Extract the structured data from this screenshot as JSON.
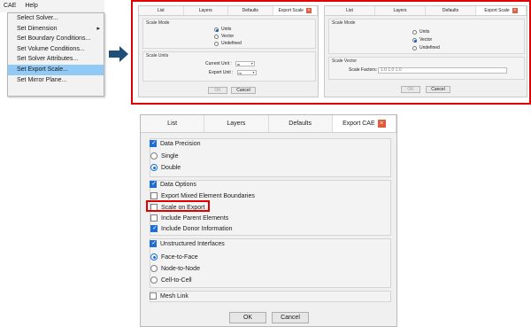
{
  "menubar": {
    "items": [
      "CAE",
      "Help"
    ]
  },
  "menu": {
    "items": [
      "Select Solver...",
      "Set Dimension",
      "Set Boundary Conditions...",
      "Set Volume Conditions...",
      "Set Solver Attributes...",
      "Set Export Scale...",
      "Set Mirror Plane..."
    ],
    "submenu_arrow": "▸",
    "highlight_color": "#91c9f7"
  },
  "arrow": {
    "color": "#1f4e79",
    "icon": "right-arrow-icon"
  },
  "accent": {
    "red_frame": "#e00000",
    "checked_blue": "#1e6ed3",
    "close_orange": "#e05c3d"
  },
  "left_dialog": {
    "tabs": [
      "List",
      "Layers",
      "Defaults",
      "Export Scale"
    ],
    "close_glyph": "×",
    "scale_mode": {
      "title": "Scale Mode",
      "options": [
        "Units",
        "Vector",
        "Undefined"
      ],
      "selected": 0
    },
    "scale_units": {
      "title": "Scale Units",
      "current_unit_label": "Current Unit :",
      "current_unit_value": "m",
      "export_unit_label": "Export Unit :",
      "export_unit_value": "m"
    },
    "ok": "OK",
    "cancel": "Cancel"
  },
  "right_dialog": {
    "tabs": [
      "List",
      "Layers",
      "Defaults",
      "Export Scale"
    ],
    "close_glyph": "×",
    "scale_mode": {
      "title": "Scale Mode",
      "options": [
        "Units",
        "Vector",
        "Undefined"
      ],
      "selected": 1
    },
    "scale_vector": {
      "title": "Scale Vector",
      "factors_label": "Scale Factors:",
      "factors_value": "1.0 1.0 1.0"
    },
    "ok": "OK",
    "cancel": "Cancel"
  },
  "main_dialog": {
    "tabs": [
      "List",
      "Layers",
      "Defaults",
      "Export CAE"
    ],
    "close_glyph": "×",
    "data_precision": {
      "title": "Data Precision",
      "checked": true,
      "options": [
        "Single",
        "Double"
      ],
      "selected": 1
    },
    "data_options": {
      "title": "Data Options",
      "checked": true,
      "items": [
        {
          "label": "Export Mixed Element Boundaries",
          "checked": false
        },
        {
          "label": "Scale on Export",
          "checked": false
        },
        {
          "label": "Include Parent Elements",
          "checked": false
        },
        {
          "label": "Include Donor Information",
          "checked": true
        }
      ]
    },
    "unstructured_interfaces": {
      "title": "Unstructured Interfaces",
      "checked": true,
      "options": [
        "Face-to-Face",
        "Node-to-Node",
        "Cell-to-Cell"
      ],
      "selected": 0
    },
    "mesh_link": {
      "label": "Mesh Link",
      "checked": false
    },
    "ok": "OK",
    "cancel": "Cancel"
  }
}
